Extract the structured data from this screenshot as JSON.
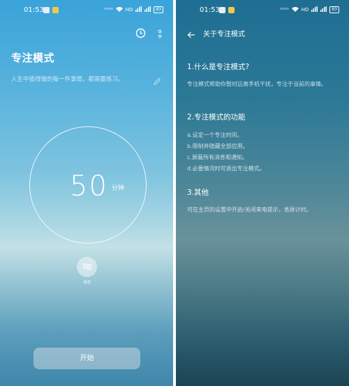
{
  "left_screen": {
    "status": {
      "time": "01:53",
      "signal": "¹ᴳ²ᴳ",
      "hd": "HD",
      "battery": "83"
    },
    "title": "专注模式",
    "motto": "人生中值得做的每一件事情，都需要练习。",
    "timer": {
      "value": "50",
      "unit": "分钟"
    },
    "sound_label": "海浪",
    "start_label": "开始"
  },
  "right_screen": {
    "status": {
      "time": "01:53",
      "signal": "¹ᴳ²ᴳ",
      "hd": "HD",
      "battery": "83"
    },
    "header_title": "关于专注模式",
    "sections": [
      {
        "heading": "1.什么是专注模式?",
        "body": "专注模式帮助你暂时远离手机干扰，专注于当前的事情。"
      },
      {
        "heading": "2.专注模式的功能",
        "items": [
          "a.设定一个专注时间。",
          "b.限制并隐藏全部应用。",
          "c.屏蔽所有消息和通知。",
          "d.必要情况时可退出专注模式。"
        ]
      },
      {
        "heading": "3.其他",
        "body": "可在主页的设置中开启/关闭来电提示，息屏计时。"
      }
    ]
  }
}
